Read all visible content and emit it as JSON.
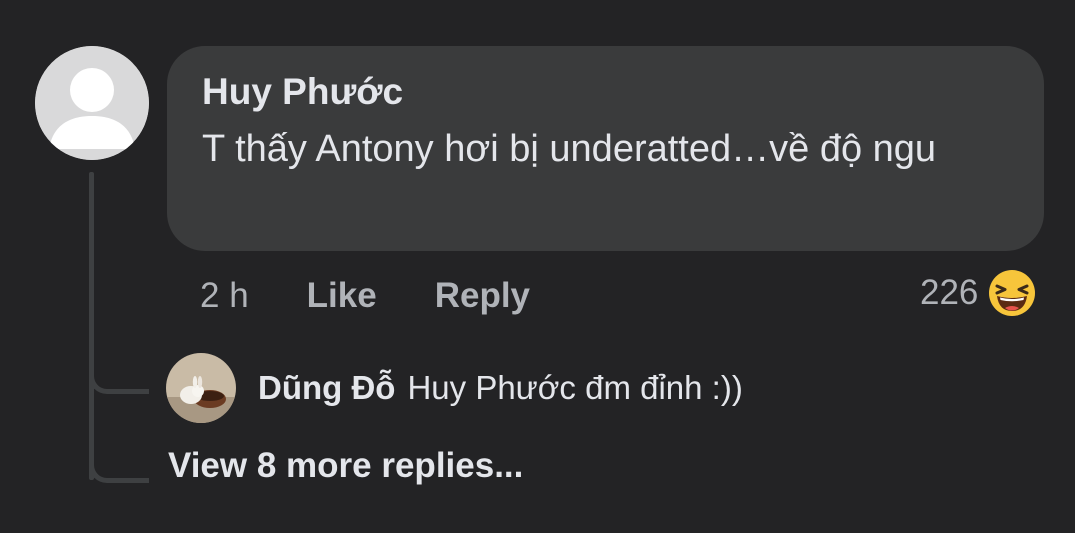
{
  "comment": {
    "author": "Huy Phước",
    "text": "T thấy Antony hơi bị underatted…về độ ngu",
    "time": "2 h",
    "like_label": "Like",
    "reply_label": "Reply",
    "reaction_count": "226",
    "reaction_icon": "laughing-emoji-icon"
  },
  "reply": {
    "author": "Dũng Đỗ",
    "text": "Huy Phước đm đỉnh :))"
  },
  "view_more_label": "View 8 more replies...",
  "colors": {
    "background": "#232325",
    "bubble": "#3a3b3c",
    "primary_text": "#e4e6eb",
    "secondary_text": "#b0b3b8",
    "thread_line": "#3e4042"
  }
}
